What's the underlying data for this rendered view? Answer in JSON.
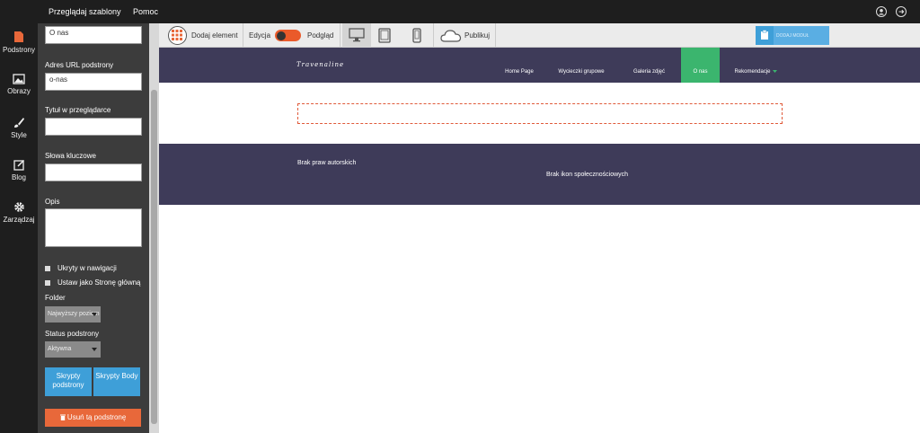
{
  "topbar": {
    "browse_templates": "Przeglądaj szablony",
    "help": "Pomoc"
  },
  "nav": {
    "pages": "Podstrony",
    "images": "Obrazy",
    "styles": "Style",
    "blog": "Blog",
    "manage": "Zarządzaj"
  },
  "panel": {
    "page_name_value": "O nas",
    "url_label": "Adres URL podstrony",
    "url_value": "o-nas",
    "browser_title_label": "Tytuł w przeglądarce",
    "browser_title_value": "",
    "keywords_label": "Słowa kluczowe",
    "keywords_value": "",
    "description_label": "Opis",
    "description_value": "",
    "hidden_nav_label": "Ukryty w nawigacji",
    "set_home_label": "Ustaw jako Stronę główną",
    "folder_label": "Folder",
    "folder_value": "Najwyższy poziom",
    "status_label": "Status podstrony",
    "status_value": "Aktywna",
    "page_scripts_label": "Skrypty podstrony",
    "body_scripts_label": "Skrypty Body",
    "delete_label": "Usuń tą podstronę"
  },
  "toolbar": {
    "add_element": "Dodaj element",
    "edit": "Edycja",
    "preview": "Podgląd",
    "publish": "Publikuj",
    "add_module": "DODAJ MODUŁ"
  },
  "site": {
    "logo": "Travenaline",
    "menu": [
      "Home Page",
      "Wycieczki grupowe",
      "Galeria zdjęć",
      "O nas",
      "Rekomendacje"
    ],
    "active_menu": "O nas",
    "footer_copyright": "Brak praw autorskich",
    "footer_social": "Brak ikon społecznościowych"
  },
  "colors": {
    "site_dark": "#3e3b59",
    "active_green": "#3bb56e",
    "accent_blue": "#3e9fd8",
    "delete_orange": "#e8683a",
    "toggle_orange": "#ea5a2a"
  }
}
